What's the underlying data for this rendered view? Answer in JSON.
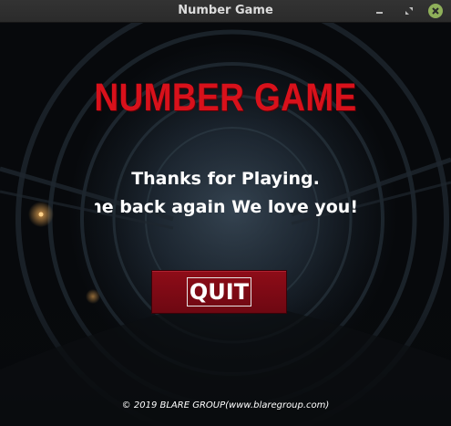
{
  "window": {
    "title": "Number Game",
    "minimize_icon": "minimize-icon",
    "maximize_icon": "maximize-icon",
    "close_icon": "close-icon",
    "close_color": "#8fb05a"
  },
  "screen": {
    "game_title": "NUMBER GAME",
    "title_color": "#d8111b",
    "message_line1": "Thanks for Playing.",
    "message_line2": "Come back again We love you!",
    "quit_label": "QUIT",
    "quit_color": "#7d0a15",
    "footer": "© 2019 BLARE GROUP(www.blaregroup.com)"
  }
}
